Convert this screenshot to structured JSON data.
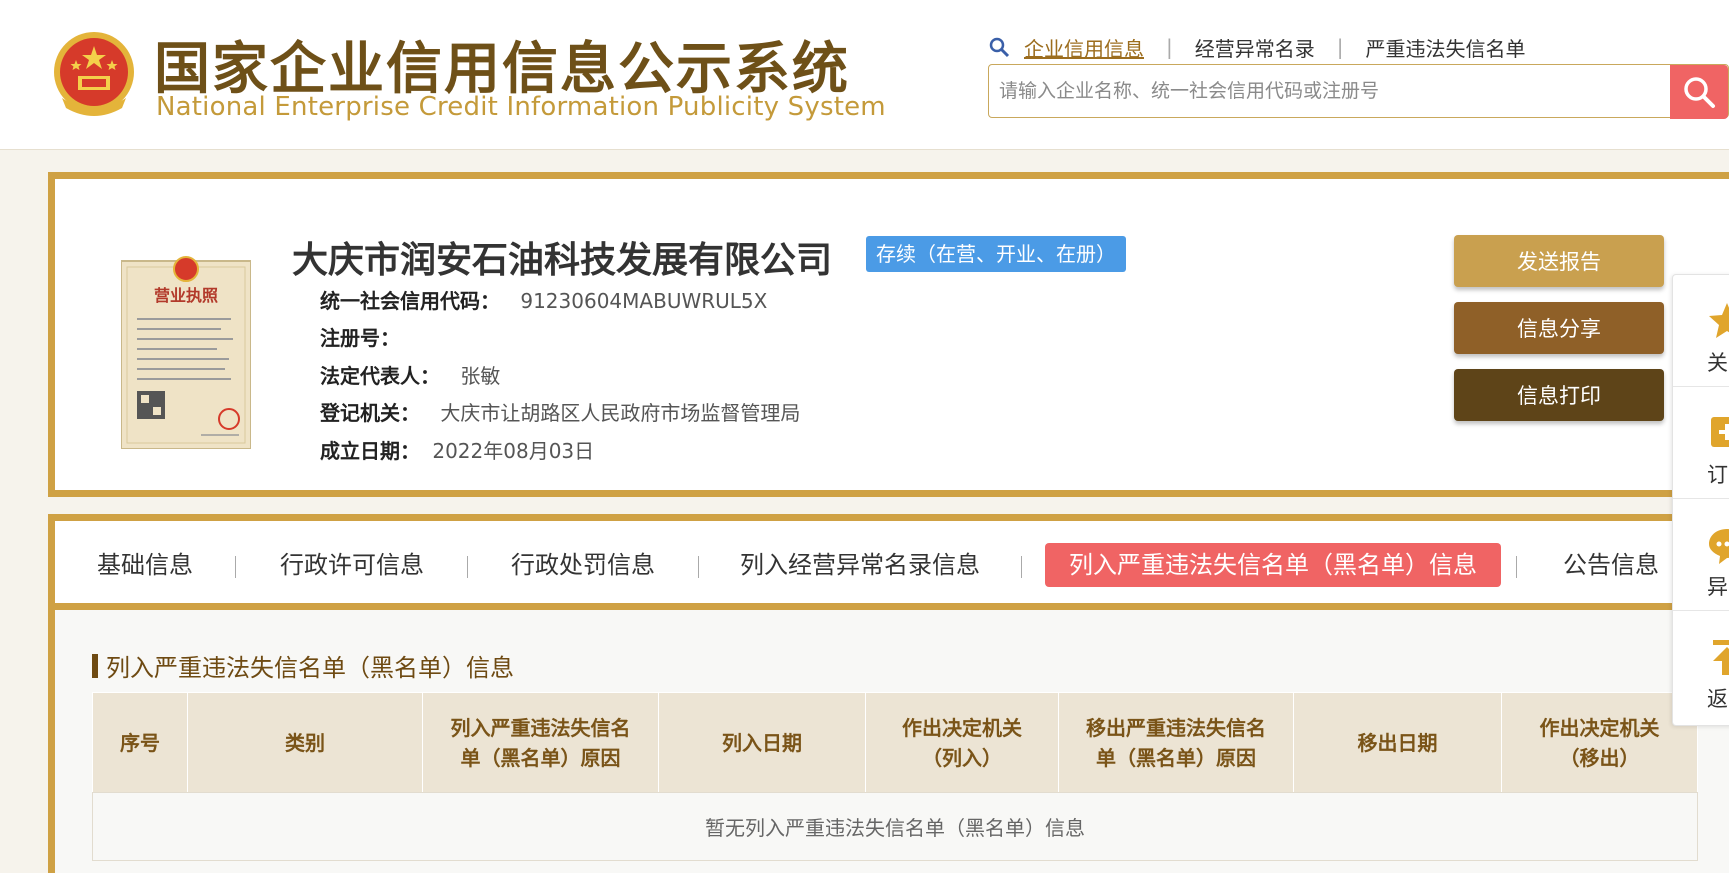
{
  "header": {
    "logo_cn": "国家企业信用信息公示系统",
    "logo_en": "National Enterprise Credit Information Publicity System",
    "nav_links": [
      "企业信用信息",
      "经营异常名录",
      "严重违法失信名单"
    ],
    "search_placeholder": "请输入企业名称、统一社会信用代码或注册号",
    "icons": {
      "search": "search-icon",
      "magnifier": "magnifier-icon",
      "emblem": "national-emblem"
    }
  },
  "company": {
    "name": "大庆市润安石油科技发展有限公司",
    "status": "存续（在营、开业、在册）",
    "credit_code_label": "统一社会信用代码：",
    "credit_code": "91230604MABUWRUL5X",
    "reg_no_label": "注册号：",
    "reg_no": "",
    "legal_rep_label": "法定代表人：",
    "legal_rep": "张敏",
    "authority_label": "登记机关：",
    "authority": "大庆市让胡路区人民政府市场监督管理局",
    "founded_label": "成立日期：",
    "founded": "2022年08月03日"
  },
  "license_image": {
    "title": "营业执照"
  },
  "actions": {
    "send_report": "发送报告",
    "share": "信息分享",
    "print": "信息打印"
  },
  "tabs": [
    "基础信息",
    "行政许可信息",
    "行政处罚信息",
    "列入经营异常名录信息",
    "列入严重违法失信名单（黑名单）信息",
    "公告信息"
  ],
  "active_tab": "列入严重违法失信名单（黑名单）信息",
  "section": {
    "title": "列入严重违法失信名单（黑名单）信息",
    "columns": [
      "序号",
      "类别",
      "列入严重违法失信名单（黑名单）原因",
      "列入日期",
      "作出决定机关（列入）",
      "移出严重违法失信名单（黑名单）原因",
      "移出日期",
      "作出决定机关（移出）"
    ],
    "empty_message": "暂无列入严重违法失信名单（黑名单）信息"
  },
  "float_panel": {
    "items": [
      {
        "label": "关",
        "icon": "star-icon"
      },
      {
        "label": "订",
        "icon": "subscribe-icon"
      },
      {
        "label": "异",
        "icon": "comment-icon"
      },
      {
        "label": "返",
        "icon": "back-to-top-icon"
      }
    ]
  },
  "colors": {
    "brand_gold": "#cfa144",
    "brand_brown": "#6e5018",
    "accent_red": "#f06464",
    "status_blue": "#4b9be6",
    "btn_send": "#c9a04f",
    "btn_share": "#8f6028",
    "btn_print": "#5e4418"
  }
}
